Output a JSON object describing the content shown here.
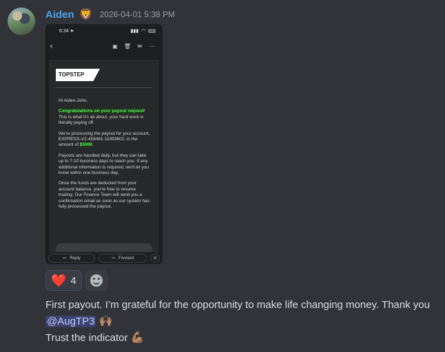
{
  "author": {
    "name": "Aiden",
    "badge_emoji": "🦁",
    "timestamp": "2026-04-01 5:38 PM"
  },
  "attachment": {
    "status_time": "6:34",
    "battery": "53",
    "email": {
      "logo_text": "TOPSTEP",
      "greeting": "Hi Aiden-John,",
      "p1_highlight": "Congratulations on your payout request",
      "p1_rest": "! This is what it's all about, your hard work is literally paying off.",
      "p2_text": "We're processing the payout for your account, EXPRESS-V2-456461-11993602, in the amount of ",
      "p2_amount": "$5000",
      "p2_end": ".",
      "p3": "Payouts are handled daily, but they can take up to 7-10 business days to reach you. If any additional information is required, we'll let you know within one business day.",
      "p4": "Once the funds are deducted from your account balance, you're free to resume trading. Our Finance Team will send you a confirmation email as soon as our system has fully processed the payout."
    },
    "reply_label": "Reply",
    "forward_label": "Forward"
  },
  "reactions": [
    {
      "emoji": "❤️",
      "count": "4"
    }
  ],
  "message": {
    "line1": "First payout. I’m grateful for the opportunity to make life changing money. Thank you",
    "mention": "@AugTP3",
    "emoji1": "🙌🏽",
    "line2": "Trust the indicator",
    "emoji2": "💪🏽"
  },
  "colors": {
    "background": "#323339",
    "username": "#4aa3f0",
    "highlight_green": "#5cf05c",
    "mention_bg": "#3c4270"
  }
}
